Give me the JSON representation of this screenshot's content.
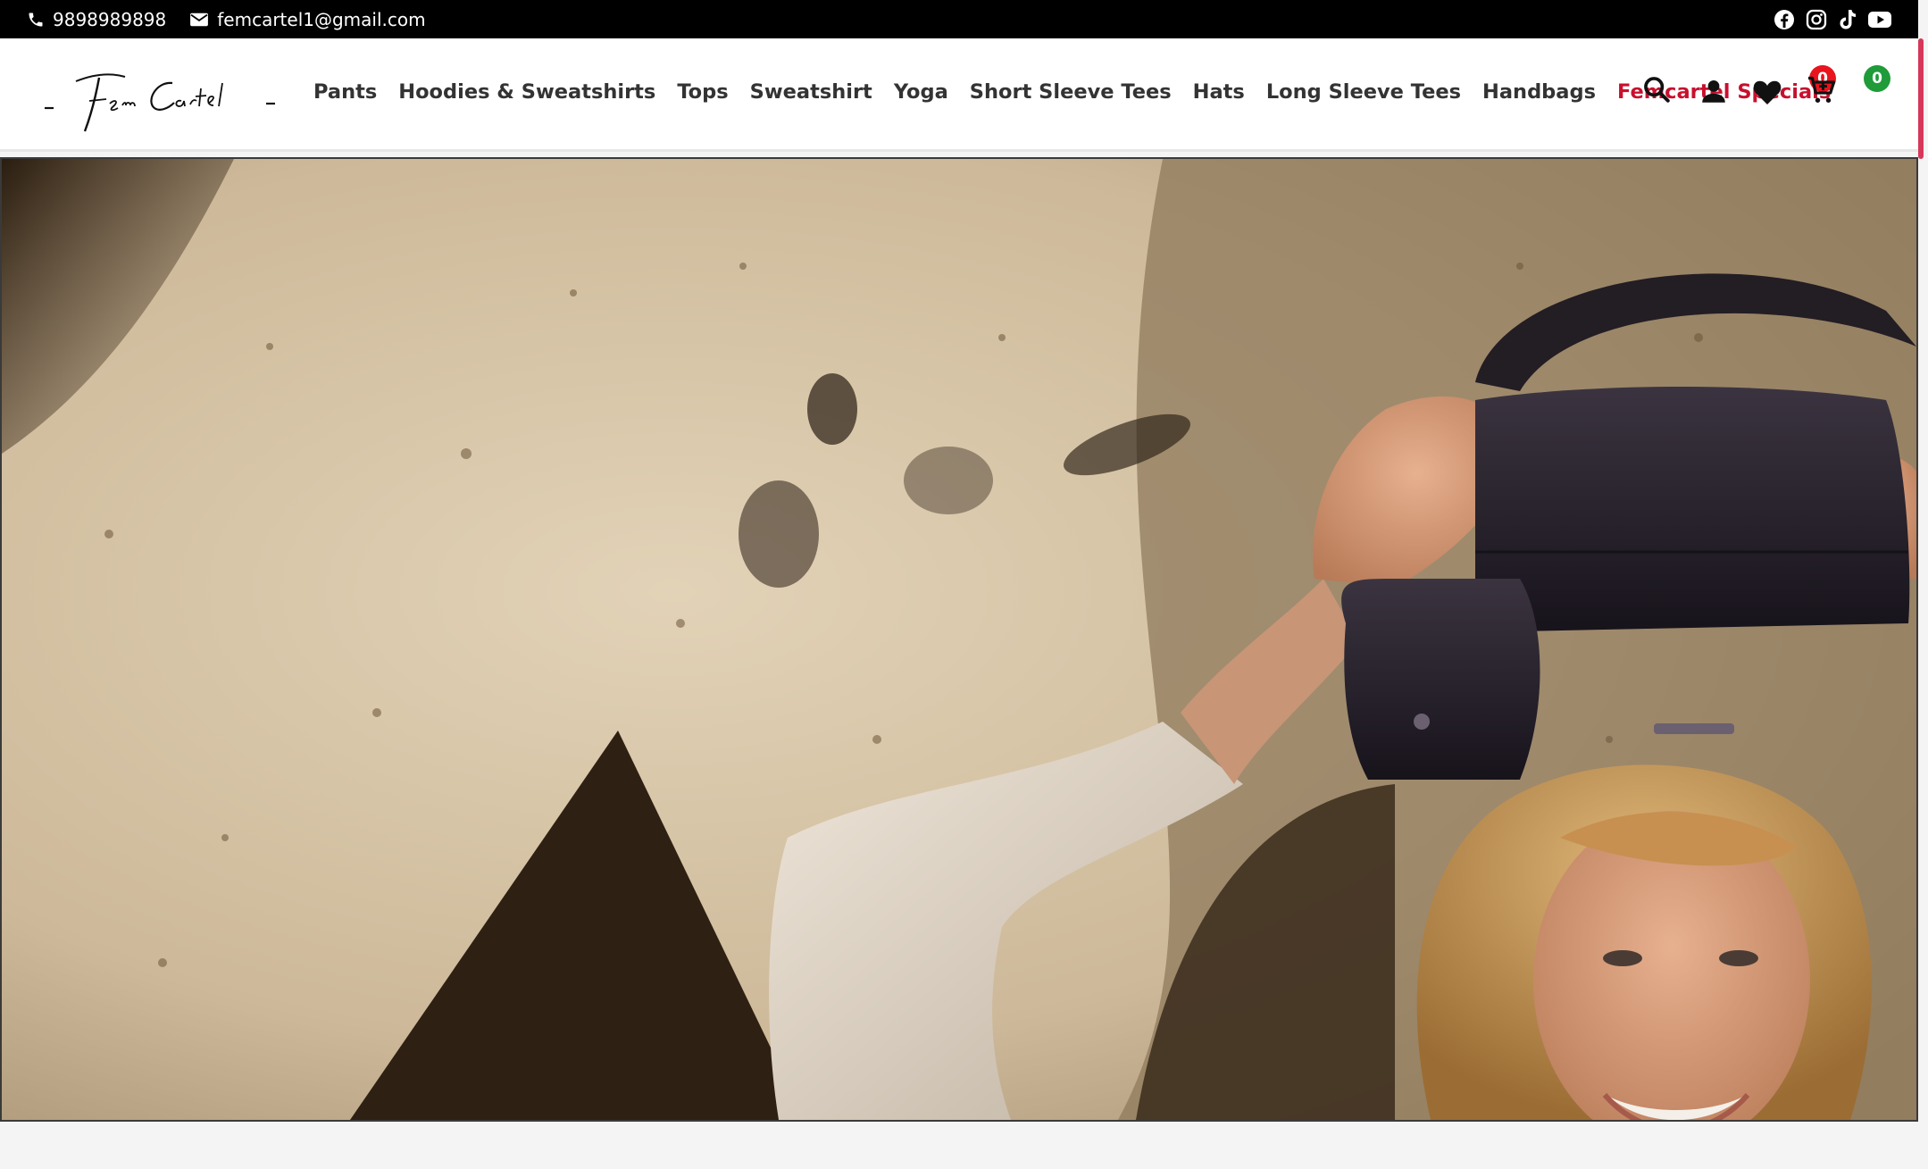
{
  "topbar": {
    "phone": "9898989898",
    "email": "femcartel1@gmail.com",
    "social_icons": [
      "facebook-icon",
      "instagram-icon",
      "tiktok-icon",
      "youtube-icon"
    ]
  },
  "brand": {
    "logo_text": "Fem Cartel"
  },
  "nav": {
    "items": [
      {
        "label": "Pants"
      },
      {
        "label": "Hoodies & Sweatshirts"
      },
      {
        "label": "Tops"
      },
      {
        "label": "Sweatshirt"
      },
      {
        "label": "Yoga"
      },
      {
        "label": "Short Sleeve Tees"
      },
      {
        "label": "Hats"
      },
      {
        "label": "Long Sleeve Tees"
      },
      {
        "label": "Handbags"
      },
      {
        "label": "Femcartel Specials"
      }
    ],
    "special_color": "#c8102e"
  },
  "header_icons": {
    "wishlist_count": "0",
    "cart_count": "0",
    "wishlist_badge_color": "#e8141e",
    "cart_badge_color": "#1f9b3a"
  },
  "hero": {
    "image": "woman-with-black-handbag-hero"
  }
}
